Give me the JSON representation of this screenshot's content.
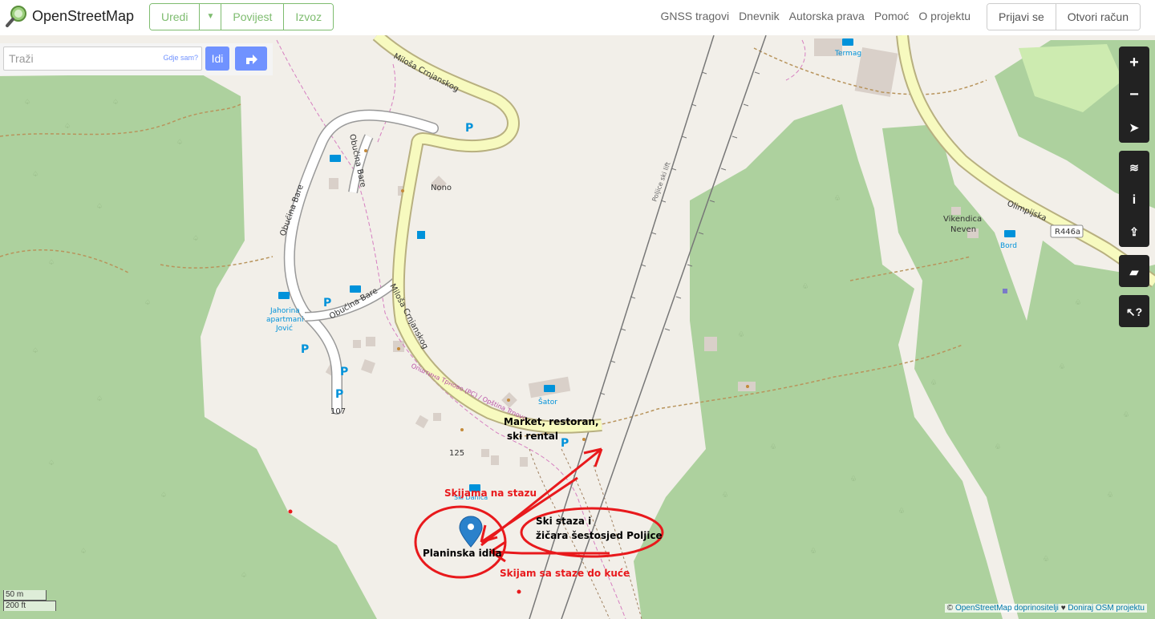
{
  "header": {
    "app_title": "OpenStreetMap",
    "edit_label": "Uredi",
    "history_label": "Povijest",
    "export_label": "Izvoz",
    "nav": [
      "GNSS tragovi",
      "Dnevnik",
      "Autorska prava",
      "Pomoć",
      "O projektu"
    ],
    "login_label": "Prijavi se",
    "signup_label": "Otvori račun"
  },
  "search": {
    "placeholder": "Traži",
    "where_label": "Gdje sam?",
    "go_label": "Idi"
  },
  "map_labels": {
    "road_milosa_top": "Miloša Crnjanskog",
    "road_milosa_mid": "Miloša Crnjanskog",
    "road_obucina_1": "Obućina Bare",
    "road_obucina_2": "Obućina Bare",
    "road_obucina_3": "Obućina Bare",
    "nono": "Nono",
    "jahorina_1": "Jahorina",
    "jahorina_2": "apartmani",
    "jahorina_3": "Jović",
    "num_107": "107",
    "num_125": "125",
    "sator": "Šator",
    "termag": "Termag",
    "vikendica_1": "Vikendica",
    "vikendica_2": "Neven",
    "bord": "Bord",
    "olimpijska": "Olimpijska",
    "r446a": "R446a",
    "poljice_lift": "Poljice ski lift",
    "opstina": "Општина Трново (РС) / Opština Trnovo",
    "ski_danica": "Ski Danica",
    "parking": "P"
  },
  "annotations": {
    "market_1": "Market, restoran,",
    "market_2": "ski rental",
    "skijama": "Skijama na stazu",
    "ski_staza_1": "Ski staza i",
    "ski_staza_2": "žičara šestosjed Poljice",
    "planinska": "Planinska idila",
    "skijam": "Skijam sa staze do kuće"
  },
  "scale": {
    "metric": "50 m",
    "imperial": "200 ft"
  },
  "attribution": {
    "copyright": "©",
    "osm_link": "OpenStreetMap doprinositelji",
    "heart": "♥",
    "donate_link": "Doniraj OSM projektu"
  },
  "colors": {
    "accent": "#7ebc6f",
    "forest": "#add19e",
    "land": "#f2efe9",
    "road_yellow": "#f7fabf",
    "annotation_red": "#e8191c",
    "marker_blue": "#2a81cb"
  }
}
